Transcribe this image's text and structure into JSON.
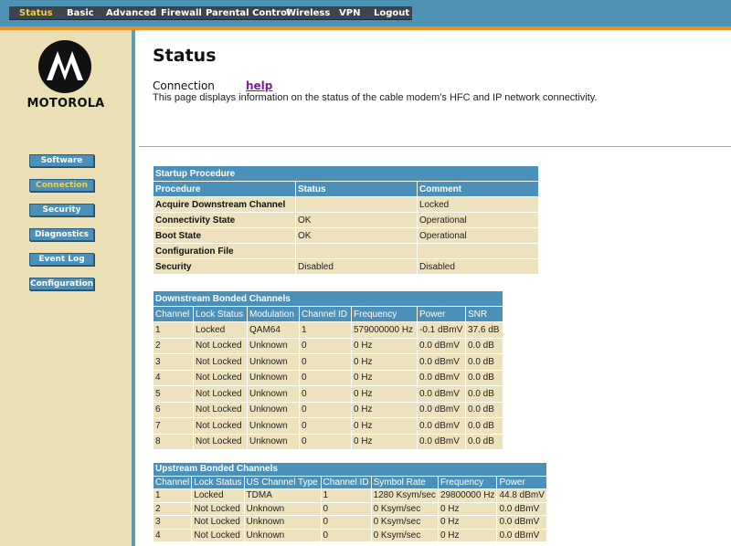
{
  "nav": {
    "items": [
      {
        "label": "Status"
      },
      {
        "label": "Basic"
      },
      {
        "label": "Advanced"
      },
      {
        "label": "Firewall"
      },
      {
        "label": "Parental Control"
      },
      {
        "label": "Wireless"
      },
      {
        "label": "VPN"
      },
      {
        "label": "Logout"
      }
    ],
    "active": "Status"
  },
  "brand": {
    "name": "MOTOROLA",
    "logo_icon": "motorola-batwing-logo"
  },
  "sidebar": {
    "items": [
      {
        "label": "Software"
      },
      {
        "label": "Connection"
      },
      {
        "label": "Security"
      },
      {
        "label": "Diagnostics"
      },
      {
        "label": "Event Log"
      },
      {
        "label": "Configuration"
      }
    ],
    "active": "Connection"
  },
  "page": {
    "title": "Status",
    "section": "Connection",
    "help_label": "help",
    "description": "This page displays information on the status of the cable modem's HFC and IP network connectivity."
  },
  "startup": {
    "caption": "Startup Procedure",
    "headers": [
      "Procedure",
      "Status",
      "Comment"
    ],
    "rows": [
      [
        "Acquire Downstream Channel",
        "",
        "Locked"
      ],
      [
        "Connectivity State",
        "OK",
        "Operational"
      ],
      [
        "Boot State",
        "OK",
        "Operational"
      ],
      [
        "Configuration File",
        "",
        ""
      ],
      [
        "Security",
        "Disabled",
        "Disabled"
      ]
    ]
  },
  "downstream": {
    "caption": "Downstream Bonded Channels",
    "headers": [
      "Channel",
      "Lock Status",
      "Modulation",
      "Channel ID",
      "Frequency",
      "Power",
      "SNR"
    ],
    "rows": [
      [
        "1",
        "Locked",
        "QAM64",
        "1",
        "579000000 Hz",
        "-0.1 dBmV",
        "37.6 dB"
      ],
      [
        "2",
        "Not Locked",
        "Unknown",
        "0",
        "0 Hz",
        "0.0 dBmV",
        "0.0 dB"
      ],
      [
        "3",
        "Not Locked",
        "Unknown",
        "0",
        "0 Hz",
        "0.0 dBmV",
        "0.0 dB"
      ],
      [
        "4",
        "Not Locked",
        "Unknown",
        "0",
        "0 Hz",
        "0.0 dBmV",
        "0.0 dB"
      ],
      [
        "5",
        "Not Locked",
        "Unknown",
        "0",
        "0 Hz",
        "0.0 dBmV",
        "0.0 dB"
      ],
      [
        "6",
        "Not Locked",
        "Unknown",
        "0",
        "0 Hz",
        "0.0 dBmV",
        "0.0 dB"
      ],
      [
        "7",
        "Not Locked",
        "Unknown",
        "0",
        "0 Hz",
        "0.0 dBmV",
        "0.0 dB"
      ],
      [
        "8",
        "Not Locked",
        "Unknown",
        "0",
        "0 Hz",
        "0.0 dBmV",
        "0.0 dB"
      ]
    ]
  },
  "upstream": {
    "caption": "Upstream Bonded Channels",
    "headers": [
      "Channel",
      "Lock Status",
      "US Channel Type",
      "Channel ID",
      "Symbol Rate",
      "Frequency",
      "Power"
    ],
    "rows": [
      [
        "1",
        "Locked",
        "TDMA",
        "1",
        "1280 Ksym/sec",
        "29800000 Hz",
        "44.8 dBmV"
      ],
      [
        "2",
        "Not Locked",
        "Unknown",
        "0",
        "0 Ksym/sec",
        "0 Hz",
        "0.0 dBmV"
      ],
      [
        "3",
        "Not Locked",
        "Unknown",
        "0",
        "0 Ksym/sec",
        "0 Hz",
        "0.0 dBmV"
      ],
      [
        "4",
        "Not Locked",
        "Unknown",
        "0",
        "0 Ksym/sec",
        "0 Hz",
        "0.0 dBmV"
      ]
    ]
  },
  "colors": {
    "header_blue": "#4a90b8",
    "cell_tan": "#ede2bd",
    "sidebar_tan": "#eadfb5",
    "accent_orange": "#ec8f1f",
    "active_yellow": "#f0d050"
  }
}
